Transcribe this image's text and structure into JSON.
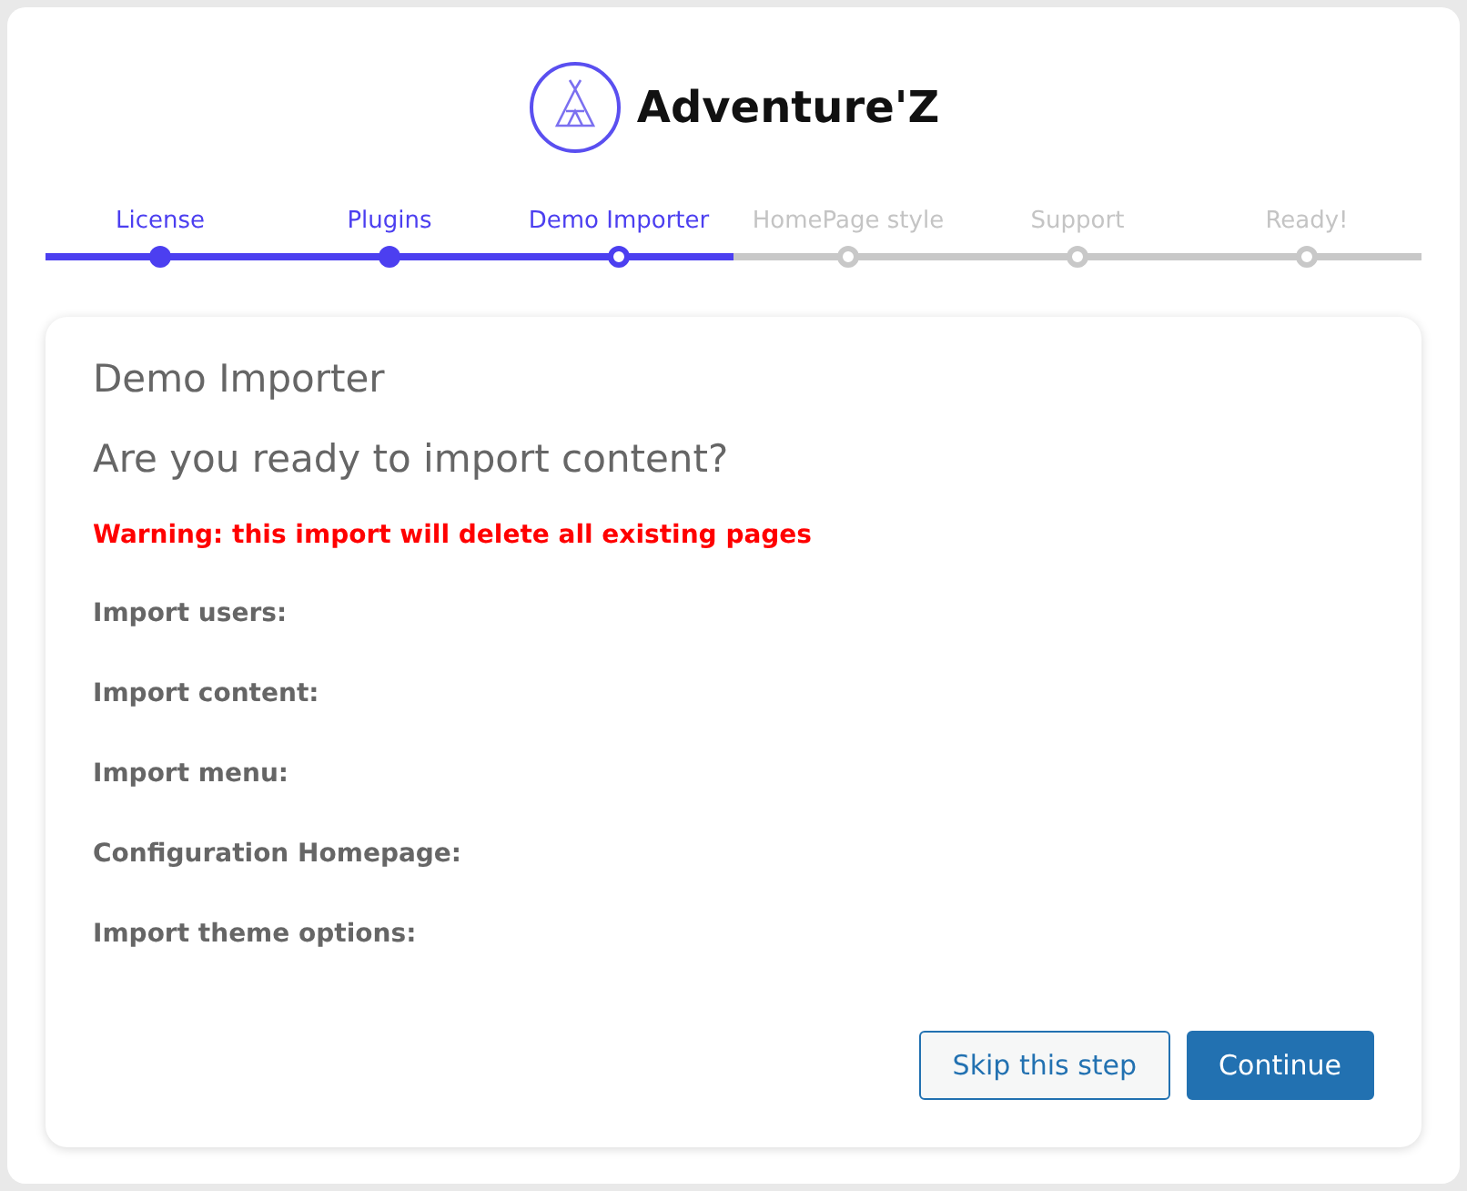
{
  "logo": {
    "text": "Adventure'Z"
  },
  "steps": [
    {
      "label": "License",
      "completed": true,
      "selected": false
    },
    {
      "label": "Plugins",
      "completed": true,
      "selected": false
    },
    {
      "label": "Demo Importer",
      "completed": false,
      "selected": true
    },
    {
      "label": "HomePage style",
      "completed": false,
      "selected": false
    },
    {
      "label": "Support",
      "completed": false,
      "selected": false
    },
    {
      "label": "Ready!",
      "completed": false,
      "selected": false
    }
  ],
  "card": {
    "title": "Demo Importer",
    "question": "Are you ready to import content?",
    "warning": "Warning: this import will delete all existing pages",
    "options": [
      "Import users:",
      "Import content:",
      "Import menu:",
      "Configuration Homepage:",
      "Import theme options:"
    ],
    "buttons": [
      {
        "label": "Skip this step",
        "kind": "secondary"
      },
      {
        "label": "Continue",
        "kind": "primary"
      }
    ]
  }
}
